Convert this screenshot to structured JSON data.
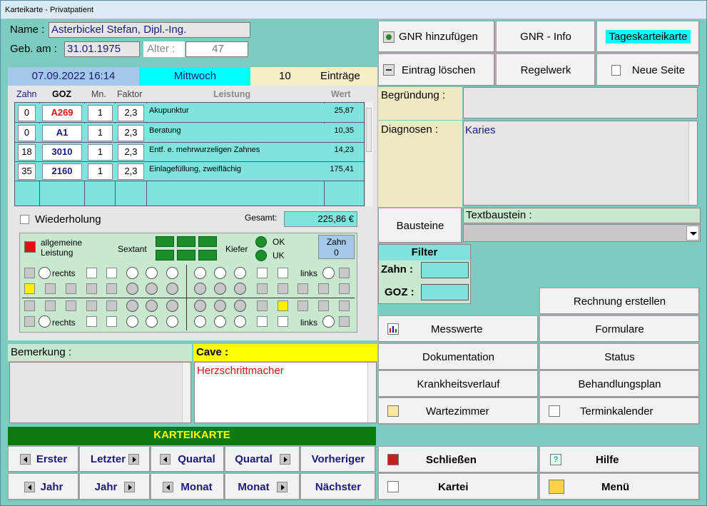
{
  "window": {
    "title": "Karteikarte - Privatpatient"
  },
  "patient": {
    "name_label": "Name :",
    "name": "Asterbickel Stefan, Dipl.-Ing.",
    "dob_label": "Geb. am :",
    "dob": "31.01.1975",
    "age_label": "Alter :",
    "age": "47"
  },
  "date": {
    "datetime": "07.09.2022 16:14",
    "weekday": "Mittwoch",
    "entries_count": "10",
    "entries_label": "Einträge"
  },
  "table": {
    "headers": [
      "Zahn",
      "GOZ",
      "Mn.",
      "Faktor",
      "Leistung",
      "Wert"
    ],
    "rows": [
      {
        "zahn": "0",
        "goz": "A269",
        "mn": "1",
        "faktor": "2,3",
        "leistung": "Akupunktur",
        "wert": "25,87"
      },
      {
        "zahn": "0",
        "goz": "A1",
        "mn": "1",
        "faktor": "2,3",
        "leistung": "Beratung",
        "wert": "10,35"
      },
      {
        "zahn": "18",
        "goz": "3010",
        "mn": "1",
        "faktor": "2,3",
        "leistung": "Entf. e. mehrwurzeligen Zahnes",
        "wert": "14,23"
      },
      {
        "zahn": "35",
        "goz": "2160",
        "mn": "1",
        "faktor": "2,3",
        "leistung": "Einlagefüllung, zweiflächig",
        "wert": "175,41"
      }
    ]
  },
  "wiederholung_label": "Wiederholung",
  "gesamt_label": "Gesamt:",
  "gesamt_value": "225,86 €",
  "chart": {
    "allgemeine": "allgemeine",
    "leistung": "Leistung",
    "sextant": "Sextant",
    "kiefer": "Kiefer",
    "ok": "OK",
    "uk": "UK",
    "zahn_label": "Zahn",
    "zahn_value": "0",
    "rechts": "rechts",
    "links": "links"
  },
  "bemerkung": {
    "label": "Bemerkung :",
    "value": ""
  },
  "cave": {
    "label": "Cave :",
    "value": "Herzschrittmacher"
  },
  "nav": {
    "title": "KARTEIKARTE",
    "erster": "Erster",
    "letzter": "Letzter",
    "quartal": "Quartal",
    "vorheriger": "Vorheriger",
    "jahr": "Jahr",
    "monat": "Monat",
    "naechster": "Nächster"
  },
  "top_buttons": {
    "gnr_add": "GNR hinzufügen",
    "gnr_info": "GNR - Info",
    "tageskarteikarte": "Tageskarteikarte",
    "eintrag_loeschen": "Eintrag löschen",
    "regelwerk": "Regelwerk",
    "neue_seite": "Neue Seite"
  },
  "begruendung": {
    "label": "Begründung :",
    "value": ""
  },
  "diagnosen": {
    "label": "Diagnosen :",
    "value": "Karies"
  },
  "bausteine": "Bausteine",
  "textbaustein_label": "Textbaustein :",
  "textbaustein_value": "",
  "filter": {
    "title": "Filter",
    "zahn": "Zahn :",
    "goz": "GOZ :"
  },
  "right_buttons": {
    "rechnung": "Rechnung erstellen",
    "messwerte": "Messwerte",
    "formulare": "Formulare",
    "dokumentation": "Dokumentation",
    "status": "Status",
    "krankheitsverlauf": "Krankheitsverlauf",
    "behandlungsplan": "Behandlungsplan",
    "wartezimmer": "Wartezimmer",
    "terminkalender": "Terminkalender",
    "schliessen": "Schließen",
    "hilfe": "Hilfe",
    "kartei": "Kartei",
    "menu": "Menü"
  },
  "colors": {
    "background": "#7ccdc0",
    "row": "#7fe3de",
    "nav_green": "#0b7a10",
    "cave_yellow": "#ffff00",
    "highlight_cyan": "#00ffff"
  }
}
